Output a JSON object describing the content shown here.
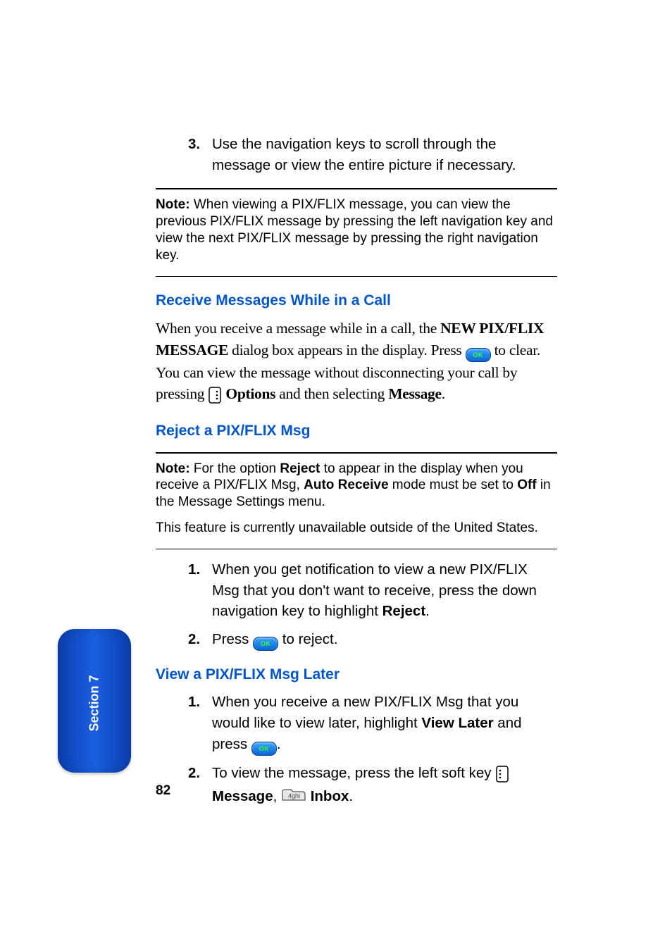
{
  "step3": {
    "num": "3.",
    "text": "Use the navigation keys to scroll through the message or view the entire picture if necessary."
  },
  "note1": {
    "label": "Note:",
    "text": " When viewing a PIX/FLIX message, you can view the previous PIX/FLIX message by pressing the left navigation key and view the next PIX/FLIX message by pressing the right navigation key."
  },
  "h1": "Receive Messages While in a Call",
  "para1": {
    "a": "When you receive a message while in a call, the ",
    "b1": "NEW PIX/FLIX MESSAGE",
    "c": " dialog box appears in the display. Press ",
    "d": " to clear. You can view the message without disconnecting your call by pressing ",
    "b2": "Options",
    "e": " and then selecting ",
    "b3": "Message",
    "f": "."
  },
  "h2": "Reject a PIX/FLIX Msg",
  "note2": {
    "label": "Note:",
    "a": " For the option ",
    "b1": "Reject",
    "b": " to appear in the display when you receive a PIX/FLIX Msg, ",
    "b2": "Auto Receive",
    "c": " mode must be set to ",
    "b3": "Off",
    "d": " in the Message Settings menu."
  },
  "unavail": "This feature is currently unavailable outside of the United States.",
  "reject": {
    "s1": {
      "num": "1.",
      "a": "When you get notification to view a new PIX/FLIX Msg that you don't want to receive, press the down navigation key to highlight ",
      "b": "Reject",
      "c": "."
    },
    "s2": {
      "num": "2.",
      "a": "Press ",
      "b": " to reject."
    }
  },
  "h3": "View a PIX/FLIX Msg Later",
  "later": {
    "s1": {
      "num": "1.",
      "a": "When you receive a new PIX/FLIX Msg that you would like to view later, highlight ",
      "b": "View Later",
      "c": " and press ",
      "d": "."
    },
    "s2": {
      "num": "2.",
      "a": "To view the message, press the left soft key ",
      "b1": "Message",
      "comma": ", ",
      "b2": "Inbox",
      "dot": "."
    }
  },
  "page": "82",
  "tab": "Section 7"
}
